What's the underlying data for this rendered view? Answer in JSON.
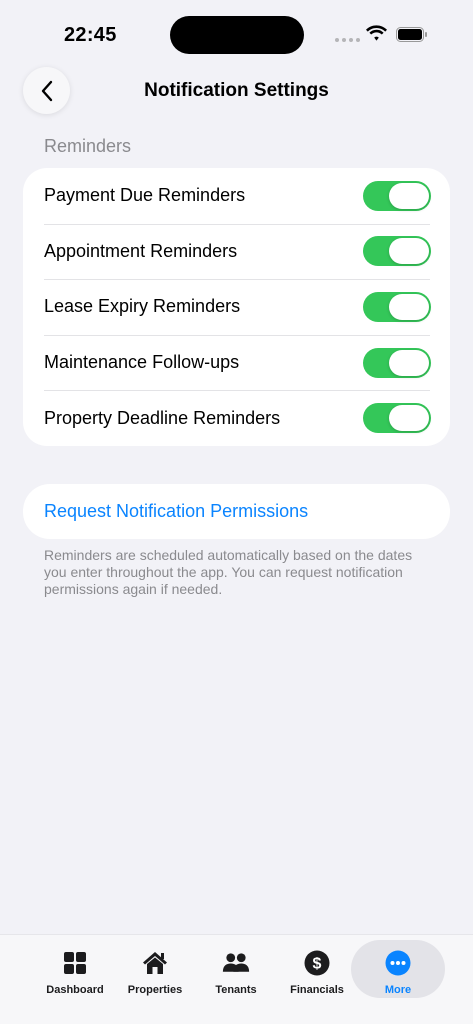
{
  "status_bar": {
    "time": "22:45"
  },
  "nav": {
    "title": "Notification Settings"
  },
  "section": {
    "header": "Reminders"
  },
  "settings": [
    {
      "label": "Payment Due Reminders",
      "enabled": true
    },
    {
      "label": "Appointment Reminders",
      "enabled": true
    },
    {
      "label": "Lease Expiry Reminders",
      "enabled": true
    },
    {
      "label": "Maintenance Follow-ups",
      "enabled": true
    },
    {
      "label": "Property Deadline Reminders",
      "enabled": true
    }
  ],
  "request": {
    "label": "Request Notification Permissions"
  },
  "footer_note": "Reminders are scheduled automatically based on the dates you enter throughout the app. You can request notification permissions again if needed.",
  "tabs": [
    {
      "label": "Dashboard",
      "icon": "grid-icon"
    },
    {
      "label": "Properties",
      "icon": "house-icon"
    },
    {
      "label": "Tenants",
      "icon": "people-icon"
    },
    {
      "label": "Financials",
      "icon": "dollar-icon"
    },
    {
      "label": "More",
      "icon": "ellipsis-icon",
      "active": true
    }
  ],
  "colors": {
    "accent": "#0a84ff",
    "toggle_on": "#34c759",
    "background": "#f2f2f7"
  }
}
